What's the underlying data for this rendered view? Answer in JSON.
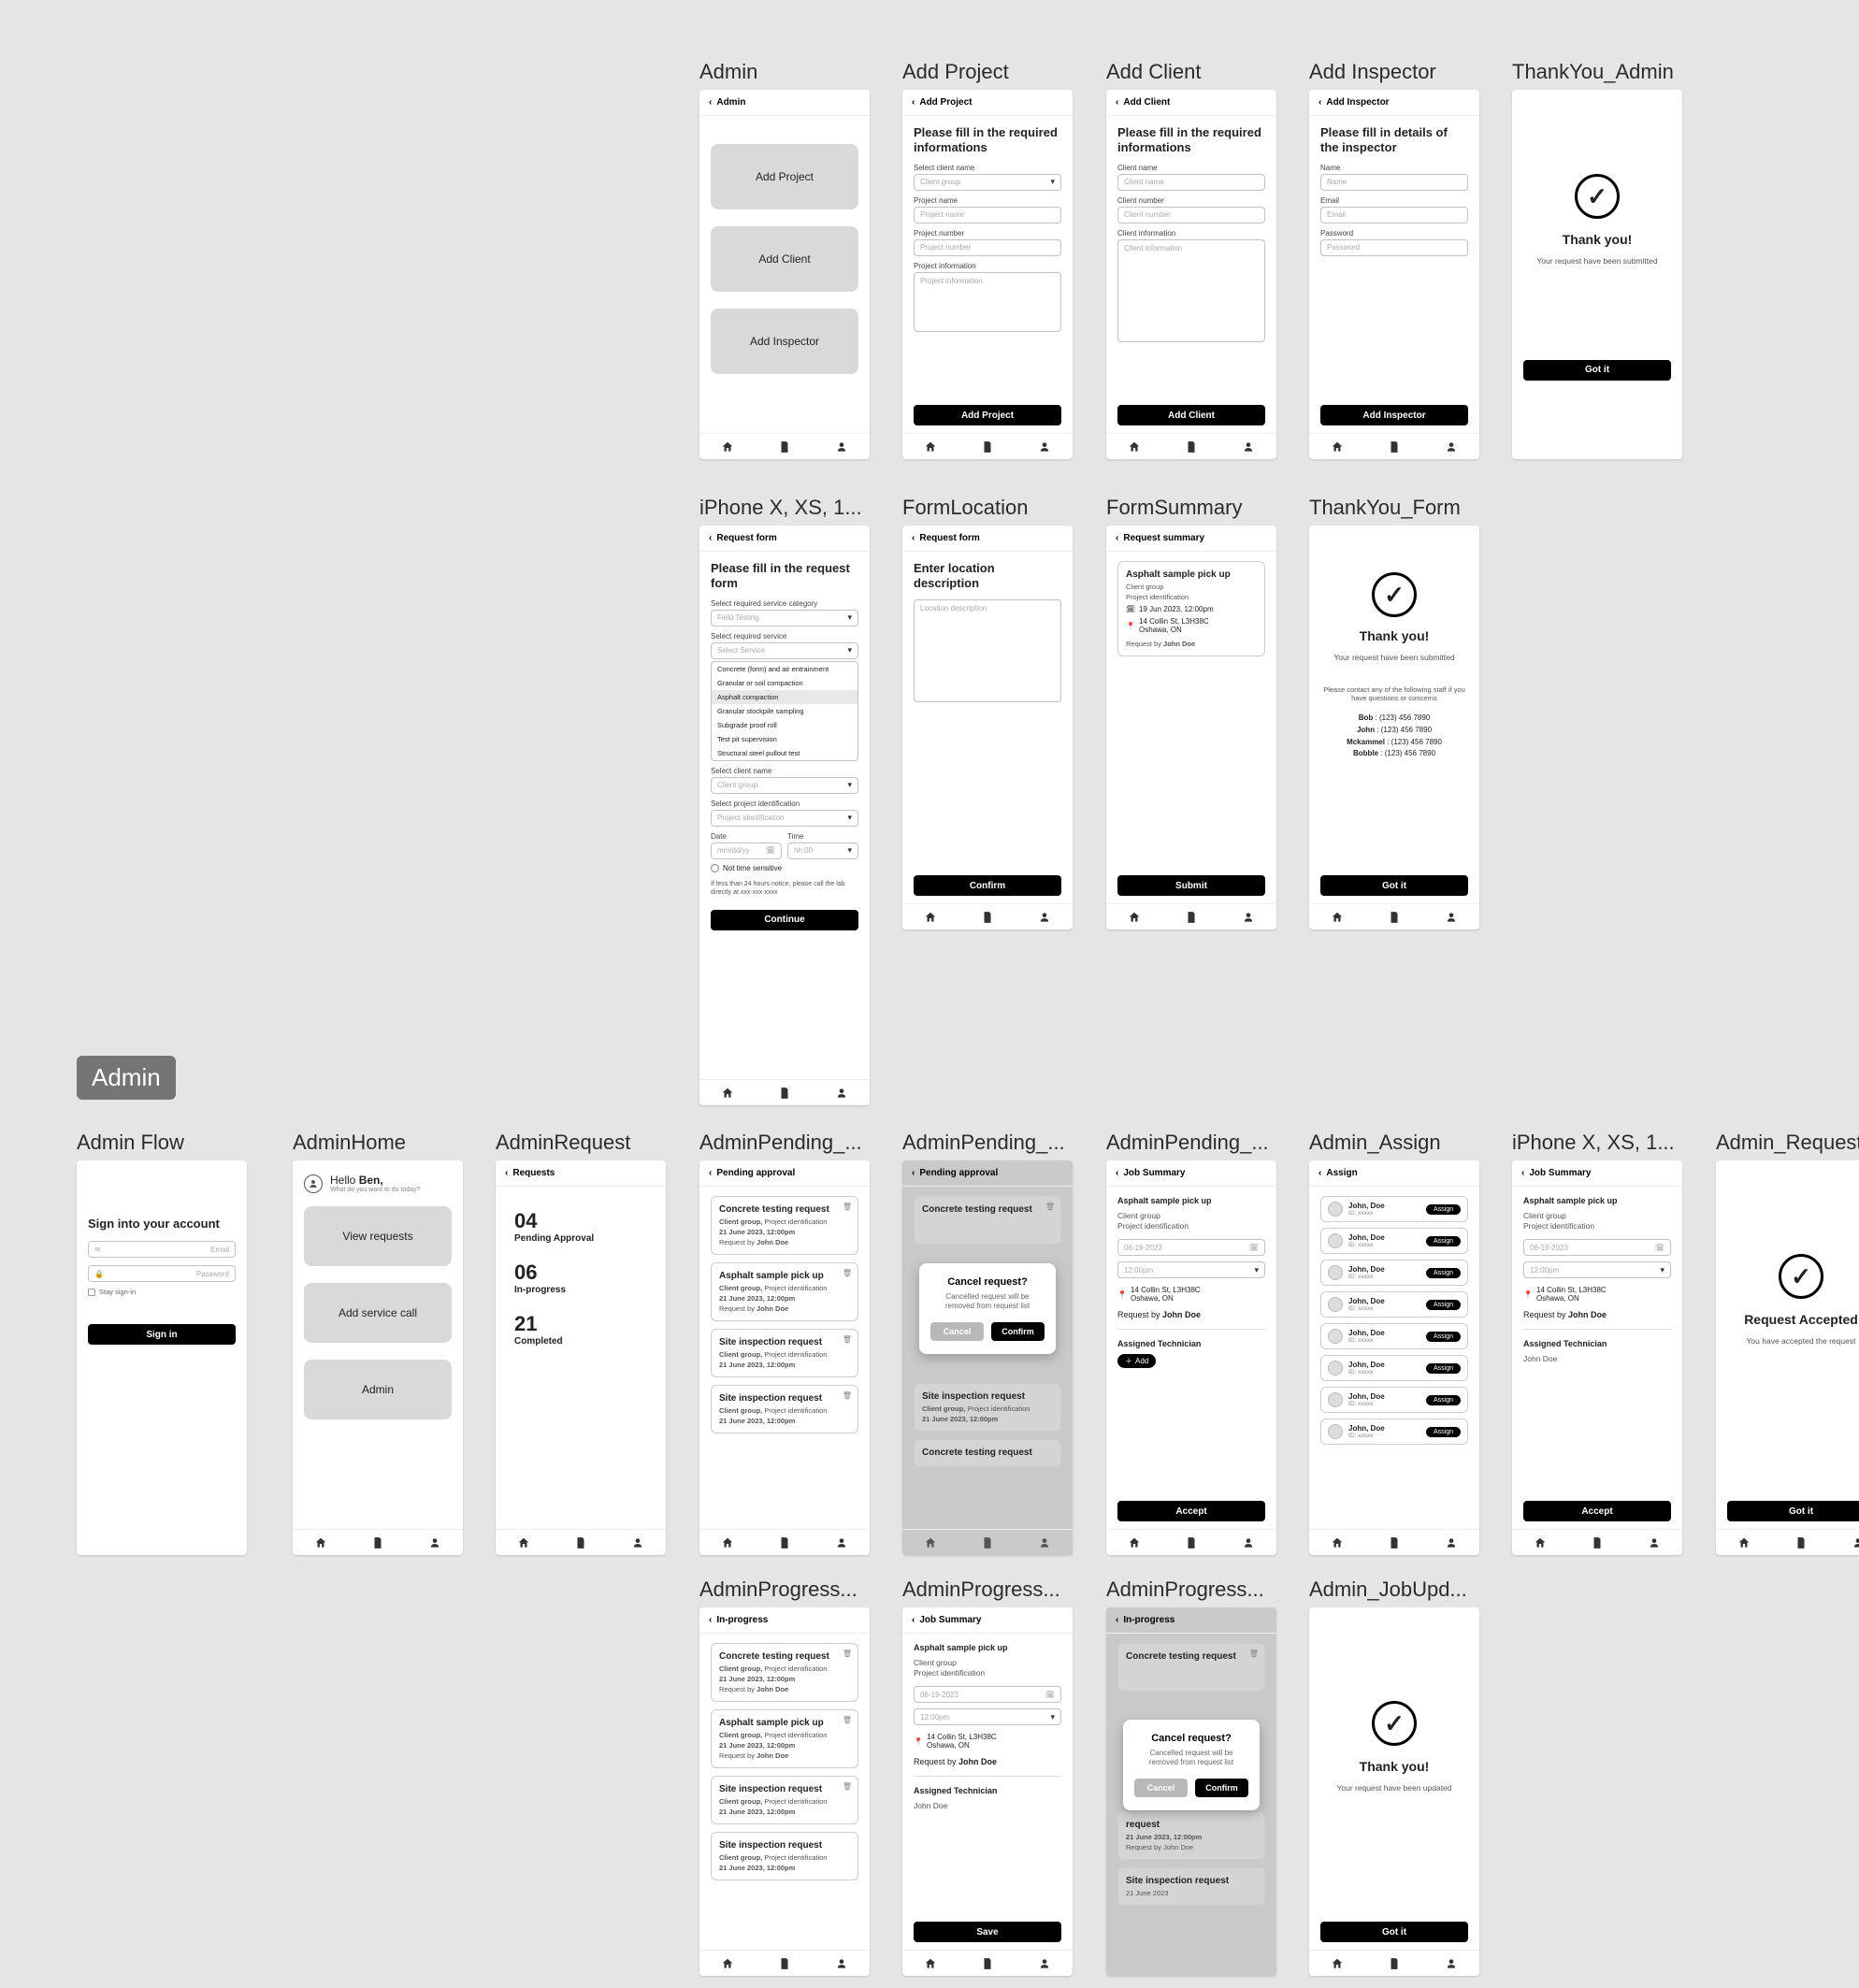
{
  "badge": "Admin",
  "row1": {
    "admin": {
      "label": "Admin",
      "header": "Admin",
      "btn1": "Add Project",
      "btn2": "Add Client",
      "btn3": "Add Inspector"
    },
    "addProject": {
      "label": "Add Project",
      "header": "Add Project",
      "title": "Please fill in the required informations",
      "f1l": "Select client name",
      "f1p": "Client group",
      "f2l": "Project name",
      "f2p": "Project name",
      "f3l": "Project number",
      "f3p": "Project number",
      "f4l": "Project information",
      "f4p": "Project information",
      "btn": "Add Project"
    },
    "addClient": {
      "label": "Add Client",
      "header": "Add Client",
      "title": "Please fill in the required informations",
      "f1l": "Client name",
      "f1p": "Client name",
      "f2l": "Client number",
      "f2p": "Client number",
      "f3l": "Client information",
      "f3p": "Client information",
      "btn": "Add Client"
    },
    "addInspector": {
      "label": "Add Inspector",
      "header": "Add Inspector",
      "title": "Please fill in details of the inspector",
      "f1l": "Name",
      "f1p": "Name",
      "f2l": "Email",
      "f2p": "Email",
      "f3l": "Password",
      "f3p": "Password",
      "btn": "Add Inspector"
    },
    "thank": {
      "label": "ThankYou_Admin",
      "t": "Thank you!",
      "s": "Your request have been submitted",
      "btn": "Got it"
    }
  },
  "row2": {
    "form": {
      "label": "iPhone X, XS, 1...",
      "header": "Request form",
      "title": "Please fill in the request form",
      "f1l": "Select required service category",
      "f1p": "Field Testing",
      "f2l": "Select required service",
      "f2p": "Select Service",
      "opts": [
        "Concrete (form) and air entrainment",
        "Granular or soil compaction",
        "Asphalt compaction",
        "Granular stockpile sampling",
        "Subgrade proof roll",
        "Test pit supervision",
        "Structural steel pullout test"
      ],
      "f3l": "Select client name",
      "f3p": "Client group",
      "f4l": "Select project identification",
      "f4p": "Project identification",
      "dl": "Date",
      "dp": "mm/dd/yy",
      "tl": "Time",
      "tp": "hh:00",
      "nts": "Not time sensitive",
      "note": "If less than 24 hours notice, please call the lab directly at xxx-xxx-xxxx",
      "btn": "Continue"
    },
    "loc": {
      "label": "FormLocation",
      "header": "Request form",
      "title": "Enter location description",
      "p": "Location description",
      "btn": "Confirm"
    },
    "summary": {
      "label": "FormSummary",
      "header": "Request summary",
      "card_t": "Asphalt sample pick up",
      "cg": "Client group",
      "pi": "Project identification",
      "dt": "19 Jun 2023, 12:00pm",
      "addr1": "14 Collin St, L3H38C",
      "addr2": "Oshawa, ON",
      "req": "Request by",
      "reqn": "John Doe",
      "btn": "Submit"
    },
    "thank": {
      "label": "ThankYou_Form",
      "t": "Thank you!",
      "s": "Your request have been submitted",
      "contact": "Please contact any of the following staff if you have questions or concerns",
      "c1n": "Bob",
      "c1p": "(123) 456 7890",
      "c2n": "John",
      "c2p": "(123) 456 7890",
      "c3n": "Mckammel",
      "c3p": "(123) 456 7890",
      "c4n": "Bobble",
      "c4p": "(123) 456 7890",
      "btn": "Got it"
    }
  },
  "row3": {
    "flow": {
      "label": "Admin Flow",
      "title": "Sign into your account",
      "f1p": "Email",
      "f2p": "Password",
      "stay": "Stay sign-in",
      "btn": "Sign in"
    },
    "home": {
      "label": "AdminHome",
      "hello": "Hello",
      "name": "Ben,",
      "sub": "What do you want to do today?",
      "b1": "View requests",
      "b2": "Add service call",
      "b3": "Admin"
    },
    "req": {
      "label": "AdminRequest",
      "header": "Requests",
      "s1n": "04",
      "s1l": "Pending Approval",
      "s2n": "06",
      "s2l": "In-progress",
      "s3n": "21",
      "s3l": "Completed"
    },
    "pending": {
      "label": "AdminPending_...",
      "header": "Pending approval",
      "c1t": "Concrete testing request",
      "cg": "Client group,",
      "pi": "Project identification",
      "dt": "21 June 2023, 12:00pm",
      "req": "Request by",
      "reqn": "John Doe",
      "c2t": "Asphalt sample pick up",
      "c3t": "Site inspection request",
      "c4t": "Site inspection request"
    },
    "pendingCancel": {
      "label": "AdminPending_...",
      "header": "Pending approval",
      "bg1": "Concrete testing request",
      "pop_t": "Cancel request?",
      "pop_s": "Cancelled request will be removed from request list",
      "pop_c": "Cancel",
      "pop_k": "Confirm",
      "bg2": "Site inspection request",
      "bg3": "Concrete testing request"
    },
    "pendingDetail": {
      "label": "AdminPending_...",
      "header": "Job Summary",
      "t": "Asphalt sample pick up",
      "cg": "Client group",
      "pi": "Project identification",
      "d": "06-19-2023",
      "tm": "12:00pm",
      "addr1": "14 Collin St, L3H38C",
      "addr2": "Oshawa, ON",
      "req": "Request by",
      "reqn": "John Doe",
      "at": "Assigned Technician",
      "add": "Add",
      "btn": "Accept"
    },
    "assign": {
      "label": "Admin_Assign",
      "header": "Assign",
      "name": "John, Doe",
      "sub": "ID: xxxxx",
      "btn": "Assign"
    },
    "acceptSummary": {
      "label": "iPhone X, XS, 1...",
      "header": "Job Summary",
      "t": "Asphalt sample pick up",
      "cg": "Client group",
      "pi": "Project identification",
      "d": "06-19-2023",
      "tm": "12:00pm",
      "addr1": "14 Collin St, L3H38C",
      "addr2": "Oshawa, ON",
      "req": "Request by",
      "reqn": "John Doe",
      "at": "Assigned Technician",
      "tech": "John Doe",
      "btn": "Accept"
    },
    "accepted": {
      "label": "Admin_Request...",
      "t": "Request Accepted",
      "s": "You have accepted the request",
      "btn": "Got it"
    }
  },
  "row4": {
    "progList": {
      "label": "AdminProgress...",
      "header": "In-progress",
      "c1t": "Concrete testing request",
      "cg": "Client group,",
      "pi": "Project identification",
      "dt": "21 June 2023, 12:00pm",
      "req": "Request by",
      "reqn": "John Doe",
      "c2t": "Asphalt sample pick up",
      "c3t": "Site inspection request",
      "c4t": "Site inspection request"
    },
    "progDetail": {
      "label": "AdminProgress...",
      "header": "Job Summary",
      "t": "Asphalt sample pick up",
      "cg": "Client group",
      "pi": "Project identification",
      "d": "06-19-2023",
      "tm": "12:00pm",
      "addr1": "14 Collin St, L3H38C",
      "addr2": "Oshawa, ON",
      "req": "Request by",
      "reqn": "John Doe",
      "at": "Assigned Technician",
      "tech": "John Doe",
      "btn": "Save"
    },
    "progCancel": {
      "label": "AdminProgress...",
      "header": "In-progress",
      "bg1": "Concrete testing request",
      "pop_t": "Cancel request?",
      "pop_s": "Cancelled request will be removed from request list",
      "pop_c": "Cancel",
      "pop_k": "Confirm",
      "bg2": "request",
      "bg2sub": "21 June 2023, 12:00pm",
      "bg2r": "Request by John Doe",
      "bg3": "Site inspection request",
      "bg3sub": "21 June 2023"
    },
    "updated": {
      "label": "Admin_JobUpd...",
      "t": "Thank you!",
      "s": "Your request have been updated",
      "btn": "Got it"
    }
  }
}
